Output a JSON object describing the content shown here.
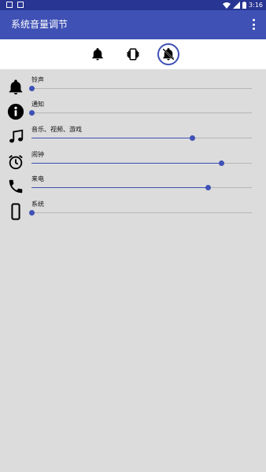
{
  "status_bar": {
    "time": "3:16",
    "left_icons": [
      "notification-icon",
      "notification-icon"
    ],
    "right_icons": [
      "wifi-icon",
      "signal-icon",
      "battery-icon"
    ]
  },
  "app_bar": {
    "title": "系统音量调节",
    "menu_icon": "more-vert-icon"
  },
  "mode_bar": {
    "modes": [
      {
        "icon": "bell-icon",
        "selected": false
      },
      {
        "icon": "vibrate-icon",
        "selected": false
      },
      {
        "icon": "mute-icon",
        "selected": true
      }
    ]
  },
  "volume": {
    "items": [
      {
        "label": "铃声",
        "icon": "bell-icon",
        "level": 0.0
      },
      {
        "label": "通知",
        "icon": "info-icon",
        "level": 0.0
      },
      {
        "label": "音乐、视频、游戏",
        "icon": "music-note-icon",
        "level": 0.73
      },
      {
        "label": "闹钟",
        "icon": "alarm-clock-icon",
        "level": 0.86
      },
      {
        "label": "来电",
        "icon": "phone-icon",
        "level": 0.8
      },
      {
        "label": "系统",
        "icon": "phone-device-icon",
        "level": 0.0
      }
    ]
  },
  "colors": {
    "status_bar": "#283593",
    "app_bar": "#3f51b5",
    "accent": "#3f51b5",
    "background": "#dcdcdc",
    "mode_bar": "#ffffff"
  }
}
